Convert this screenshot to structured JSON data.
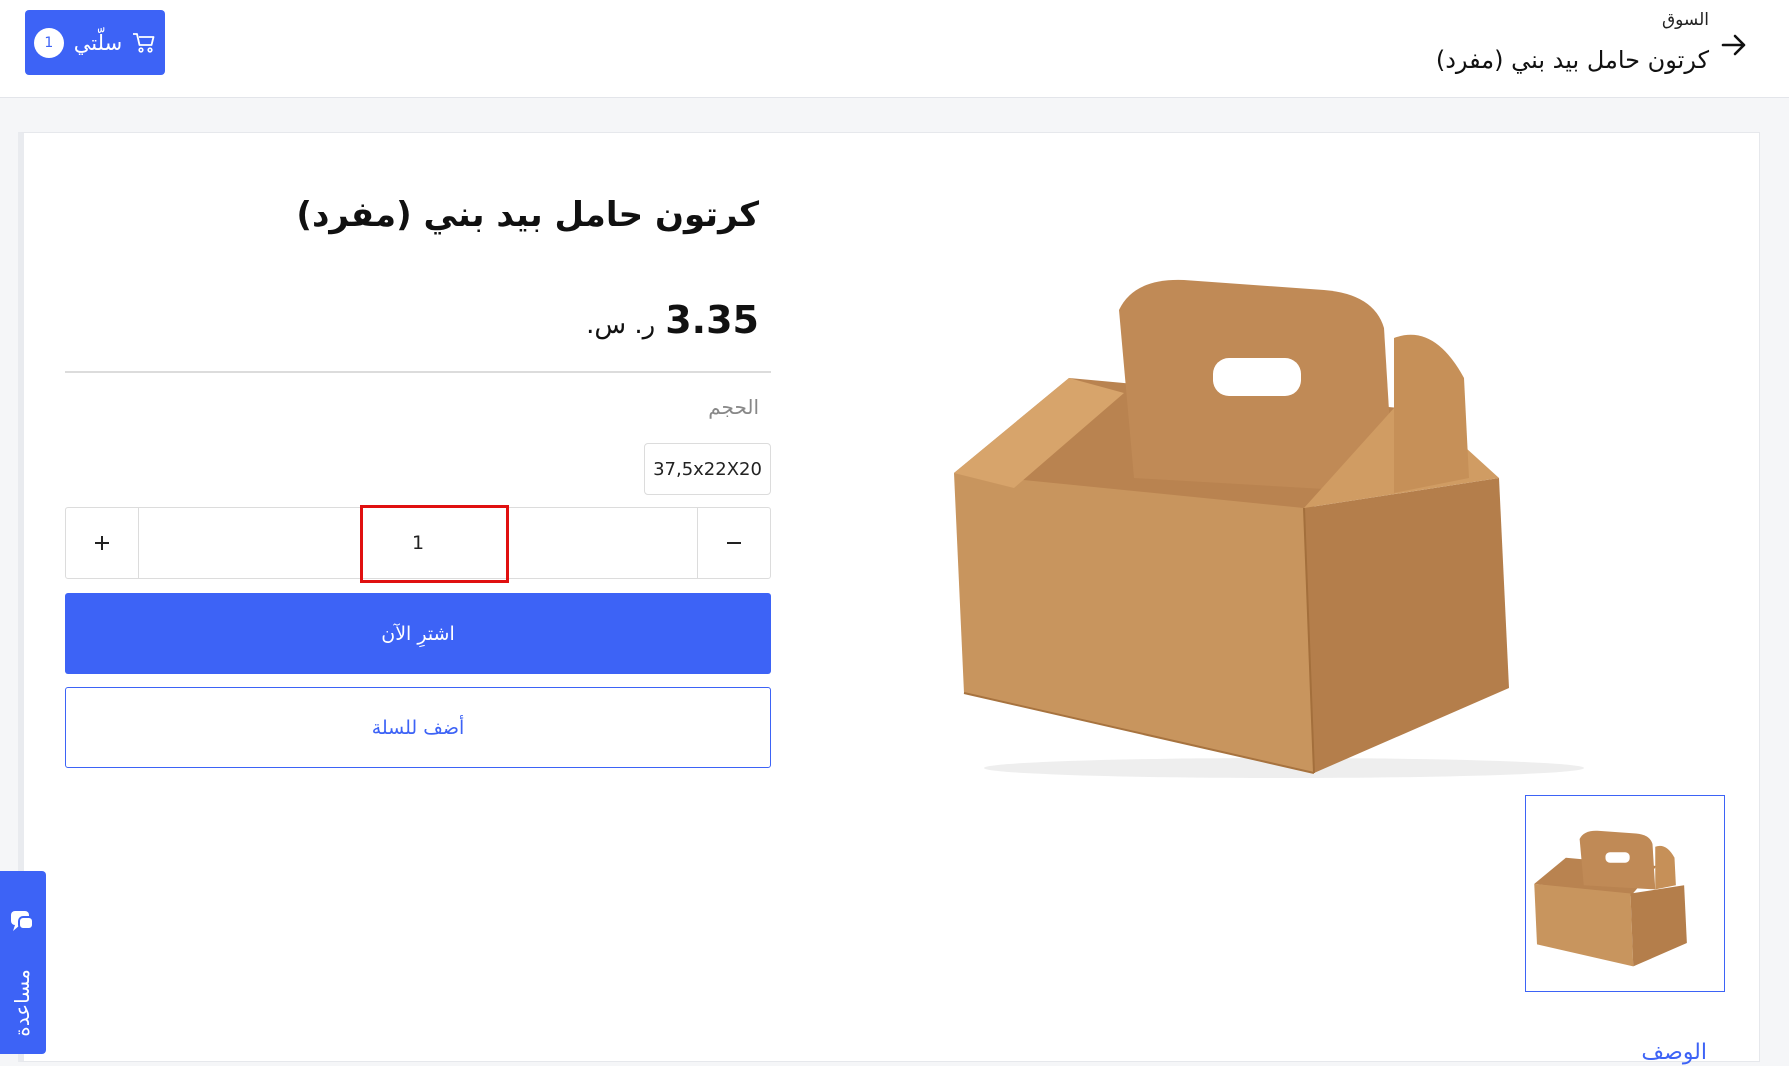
{
  "header": {
    "breadcrumb": "السوق",
    "title": "كرتون حامل بيد بني (مفرد)",
    "back_icon": "arrow-right-icon",
    "cart": {
      "label": "سلّتي",
      "count": "1",
      "icon": "cart-icon"
    }
  },
  "product": {
    "title": "كرتون حامل بيد بني (مفرد)",
    "price": "3.35",
    "currency": "ر. س.",
    "size_label": "الحجم",
    "size_option": "37,5x22X20",
    "quantity": "1",
    "buy_now_label": "اشترِ الآن",
    "add_to_cart_label": "أضف للسلة",
    "description_tab": "الوصف"
  },
  "help": {
    "label": "مساعدة",
    "icon": "chat-icon"
  },
  "colors": {
    "accent": "#3d63f6",
    "highlight": "#e01010",
    "cardboard": "#c8955e"
  }
}
